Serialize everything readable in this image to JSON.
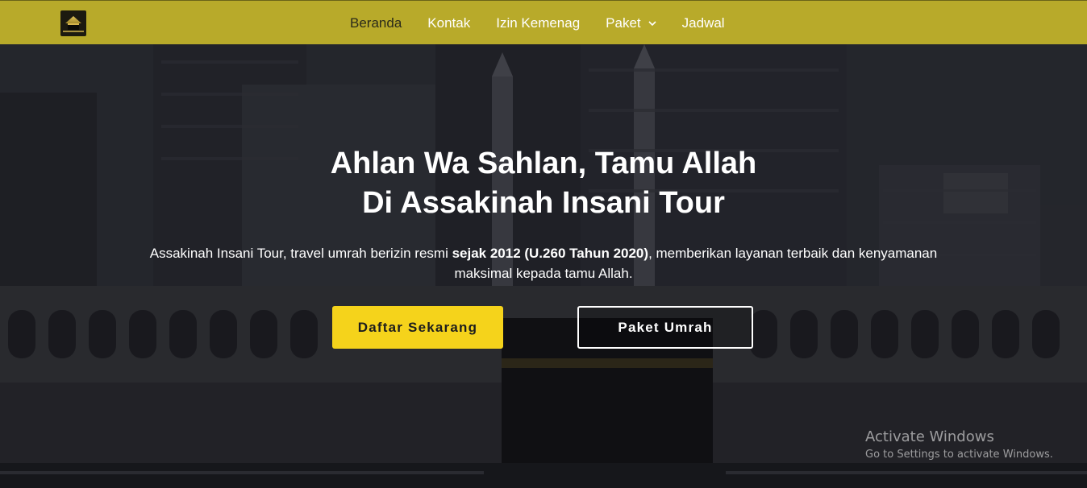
{
  "brand": {
    "logo_icon": "kaaba-logo-icon",
    "nav_color": "#b8aa2a"
  },
  "nav": {
    "items": [
      {
        "label": "Beranda",
        "active": true
      },
      {
        "label": "Kontak"
      },
      {
        "label": "Izin Kemenag"
      },
      {
        "label": "Paket",
        "icon": "chevron-down-icon"
      },
      {
        "label": "Jadwal"
      }
    ]
  },
  "hero": {
    "title_line1": "Ahlan Wa Sahlan, Tamu Allah",
    "title_line2": "Di Assakinah Insani Tour",
    "desc_prefix": "Assakinah Insani Tour, travel umrah berizin resmi ",
    "desc_bold": "sejak 2012 (U.260 Tahun 2020)",
    "desc_suffix": ", memberikan layanan terbaik dan kenyamanan maksimal kepada tamu Allah.",
    "cta_primary": "Daftar Sekarang",
    "cta_secondary": "Paket Umrah",
    "accent": "#f5d31b"
  },
  "watermark": {
    "title": "Activate Windows",
    "subtitle": "Go to Settings to activate Windows."
  }
}
